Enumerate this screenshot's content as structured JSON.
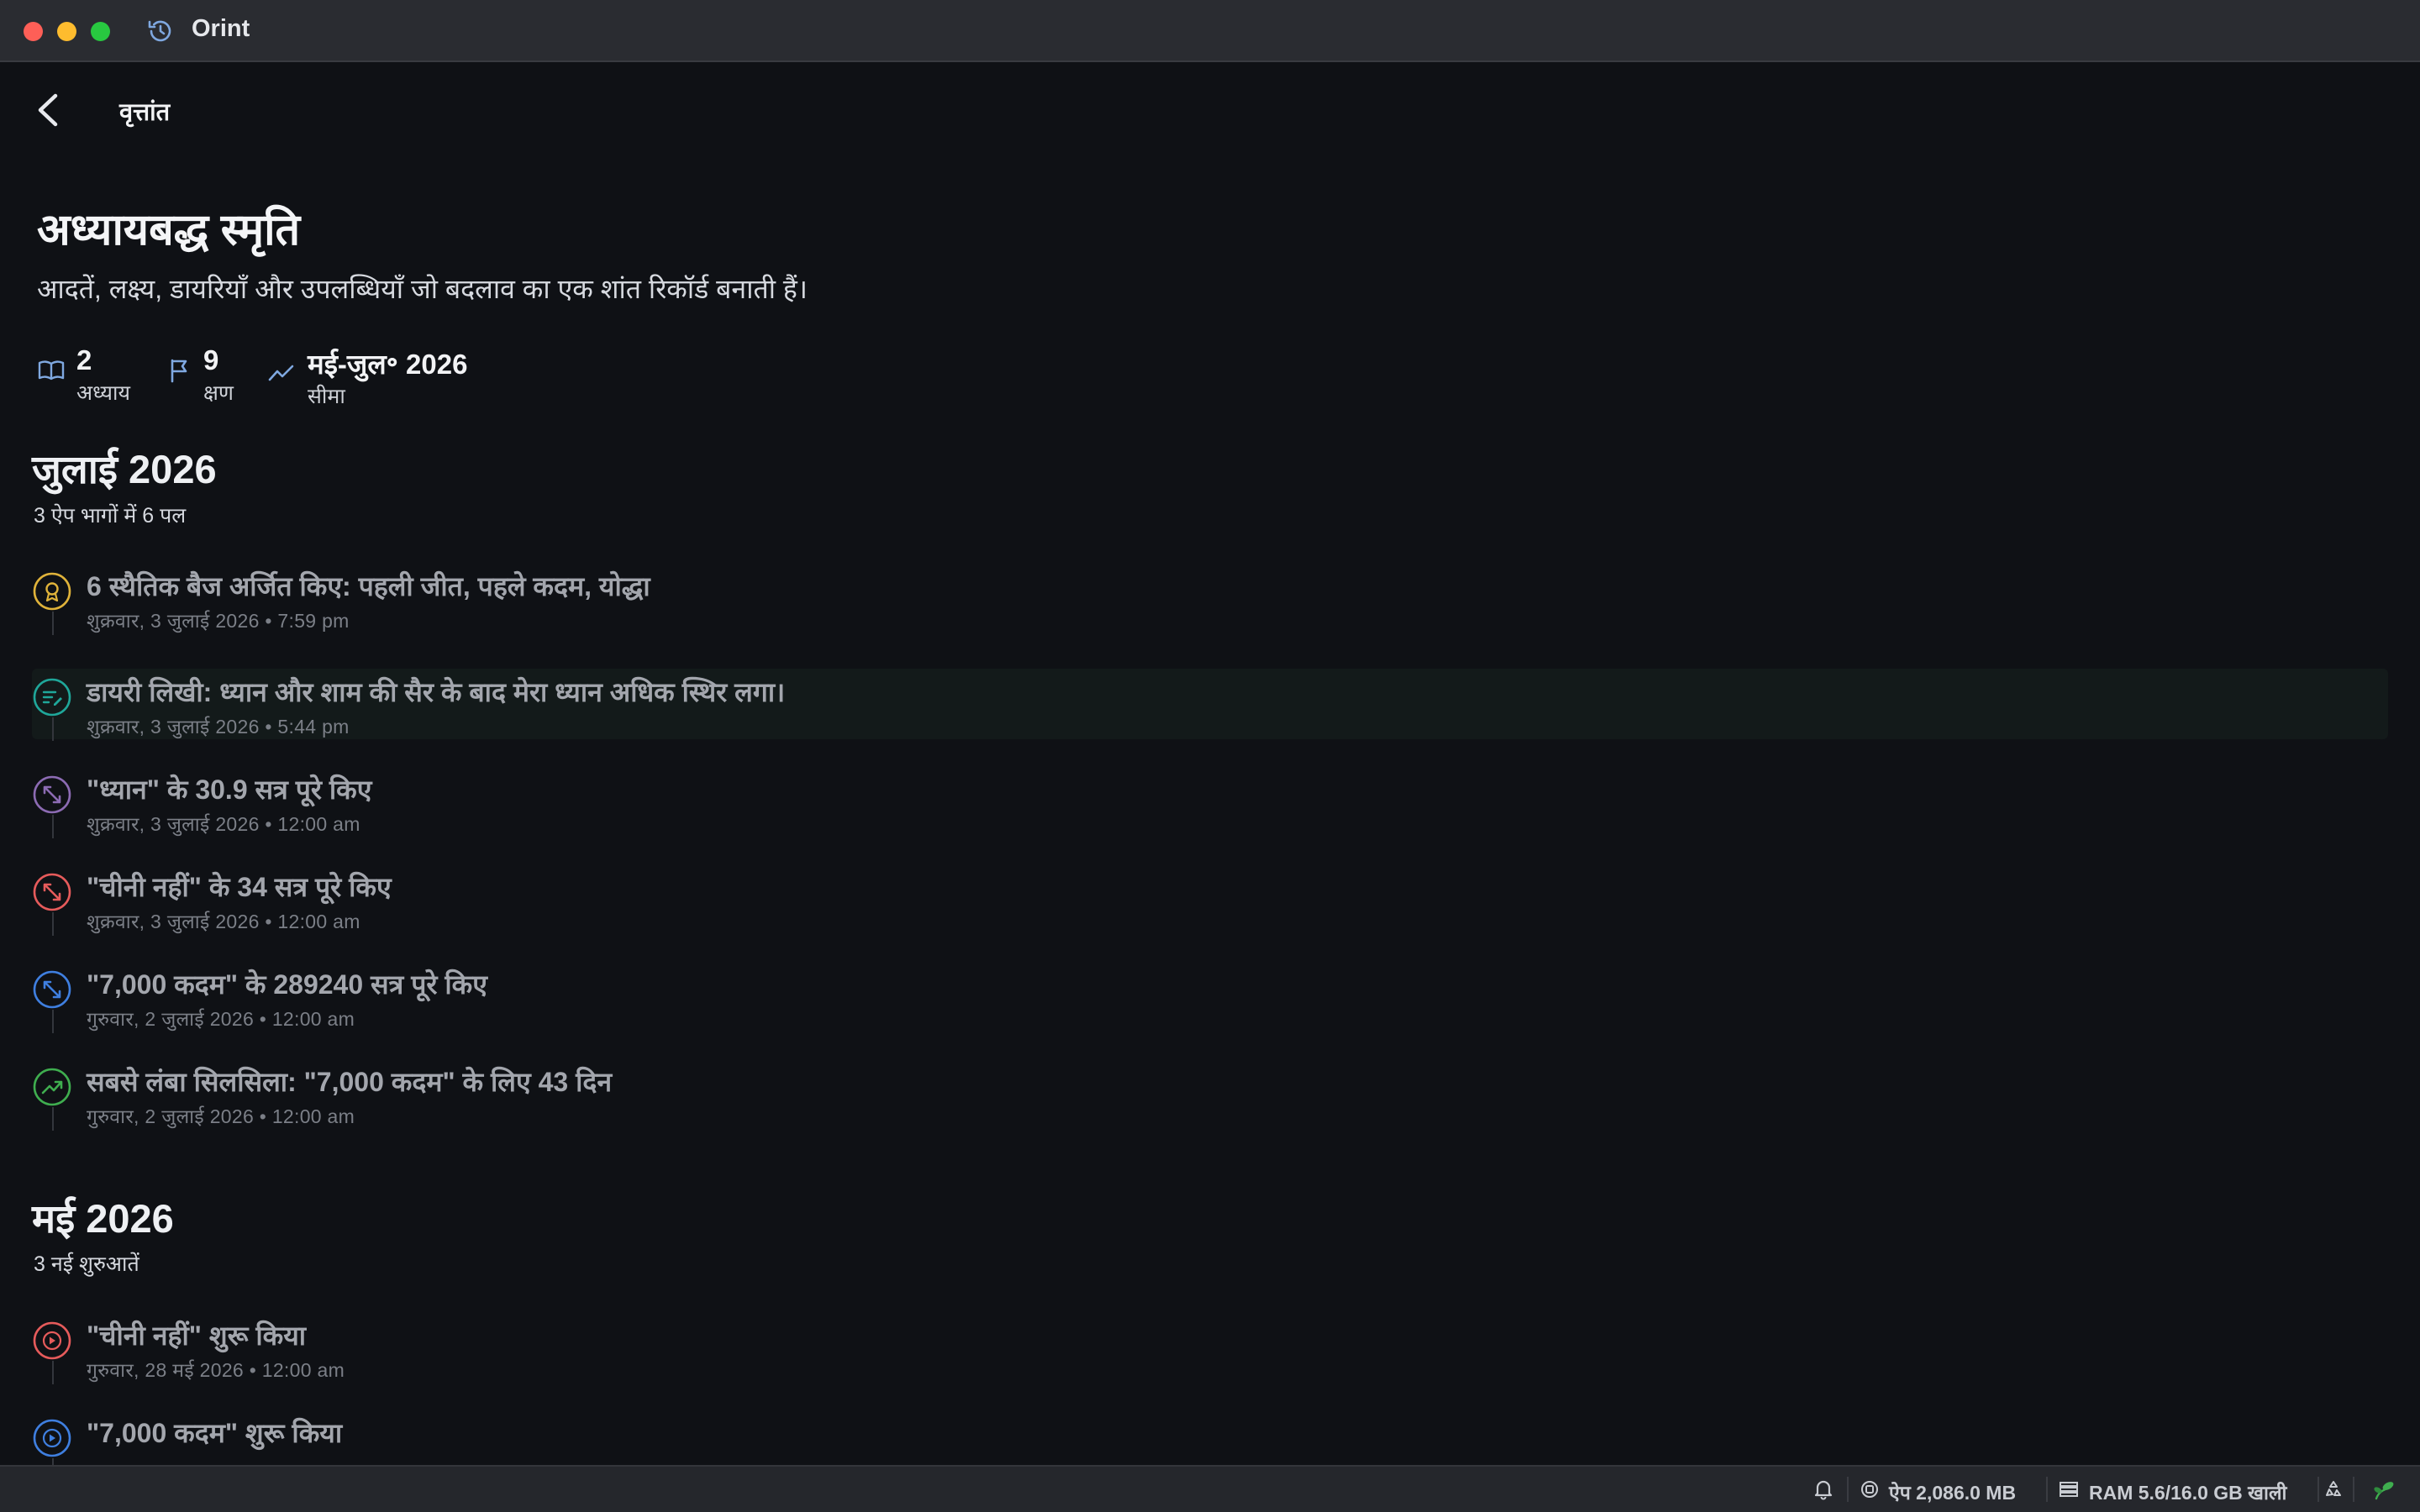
{
  "window": {
    "title": "Orint"
  },
  "nav": {
    "title": "वृत्तांत"
  },
  "header": {
    "title": "अध्यायबद्ध स्मृति",
    "subtitle": "आदतें, लक्ष्य, डायरियाँ और उपलब्धियाँ जो बदलाव का एक शांत रिकॉर्ड बनाती हैं।",
    "stats": [
      {
        "value": "2",
        "label": "अध्याय",
        "icon": "open-book-icon"
      },
      {
        "value": "9",
        "label": "क्षण",
        "icon": "flag-icon"
      },
      {
        "value": "मई-जुल॰ 2026",
        "label": "सीमा",
        "icon": "trend-icon"
      }
    ]
  },
  "sections": [
    {
      "title": "जुलाई 2026",
      "subtitle": "3 ऐप भागों में 6 पल",
      "items": [
        {
          "title": "6 स्थैतिक बैज अर्जित किए: पहली जीत, पहले कदम, योद्धा",
          "date": "शुक्रवार, 3 जुलाई 2026 • 7:59 pm",
          "icon": "badge-icon",
          "color": "#e0b33a"
        },
        {
          "title": "डायरी लिखी: ध्यान और शाम की सैर के बाद मेरा ध्यान अधिक स्थिर लगा।",
          "date": "शुक्रवार, 3 जुलाई 2026 • 5:44 pm",
          "icon": "journal-icon",
          "color": "#1fa79a"
        },
        {
          "title": "\"ध्यान\" के 30.9 सत्र पूरे किए",
          "date": "शुक्रवार, 3 जुलाई 2026 • 12:00 am",
          "icon": "arrows-icon",
          "color": "#8c6bb3"
        },
        {
          "title": "\"चीनी नहीं\" के 34 सत्र पूरे किए",
          "date": "शुक्रवार, 3 जुलाई 2026 • 12:00 am",
          "icon": "arrows-icon",
          "color": "#e65b5b"
        },
        {
          "title": "\"7,000 कदम\" के 289240 सत्र पूरे किए",
          "date": "गुरुवार, 2 जुलाई 2026 • 12:00 am",
          "icon": "arrows-icon",
          "color": "#3f7fe0"
        },
        {
          "title": "सबसे लंबा सिलसिला: \"7,000 कदम\" के लिए 43 दिन",
          "date": "गुरुवार, 2 जुलाई 2026 • 12:00 am",
          "icon": "trend-up-icon",
          "color": "#3fae4f"
        }
      ]
    },
    {
      "title": "मई 2026",
      "subtitle": "3 नई शुरुआतें",
      "items": [
        {
          "title": "\"चीनी नहीं\" शुरू किया",
          "date": "गुरुवार, 28 मई 2026 • 12:00 am",
          "icon": "play-icon",
          "color": "#e65b5b"
        },
        {
          "title": "\"7,000 कदम\" शुरू किया",
          "date": "",
          "icon": "play-icon",
          "color": "#3f7fe0"
        }
      ]
    }
  ],
  "statusbar": {
    "app_memory": "ऐप 2,086.0 MB",
    "ram": "RAM 5.6/16.0 GB खाली"
  }
}
